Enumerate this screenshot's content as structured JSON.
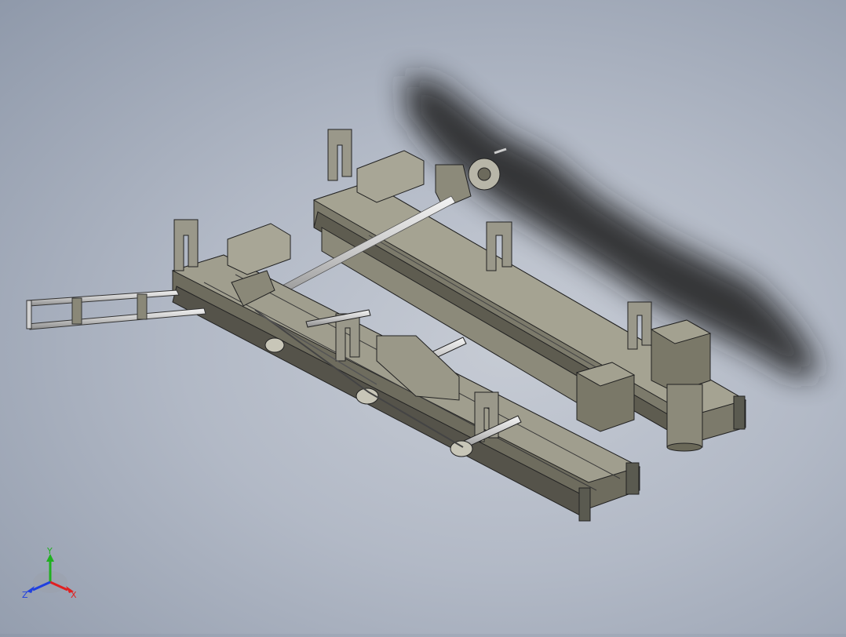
{
  "viewport": {
    "background_color": "#b8bfcb",
    "model_color": "#8a8778"
  },
  "triad": {
    "x_label": "X",
    "y_label": "Y",
    "z_label": "Z",
    "x_color": "#e02020",
    "y_color": "#20b020",
    "z_color": "#2040e0"
  }
}
